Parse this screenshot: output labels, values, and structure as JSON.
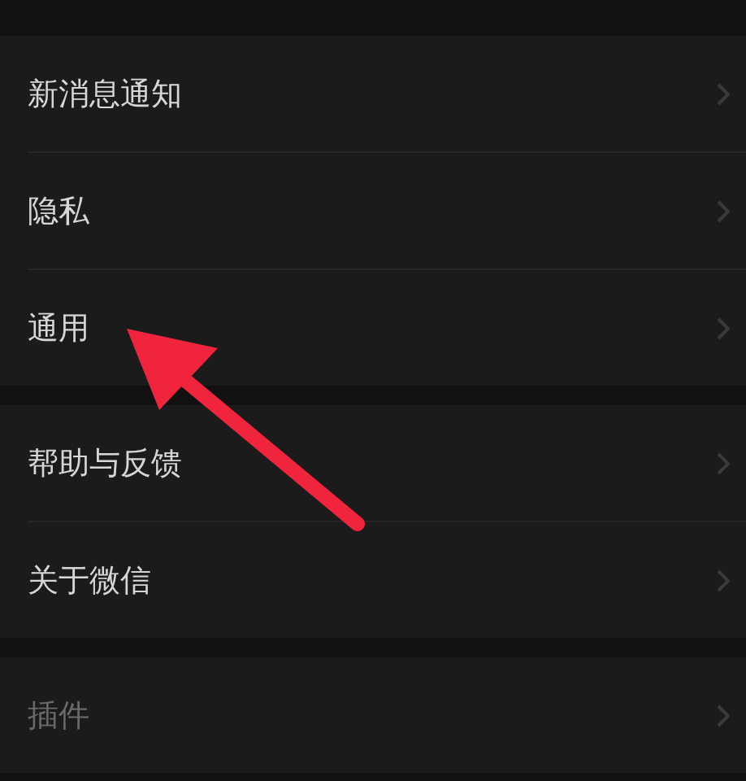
{
  "groups": [
    {
      "items": [
        {
          "label": "新消息通知",
          "dimmed": false
        },
        {
          "label": "隐私",
          "dimmed": false
        },
        {
          "label": "通用",
          "dimmed": false
        }
      ]
    },
    {
      "items": [
        {
          "label": "帮助与反馈",
          "dimmed": false
        },
        {
          "label": "关于微信",
          "dimmed": false
        }
      ]
    },
    {
      "items": [
        {
          "label": "插件",
          "dimmed": true
        }
      ]
    }
  ]
}
